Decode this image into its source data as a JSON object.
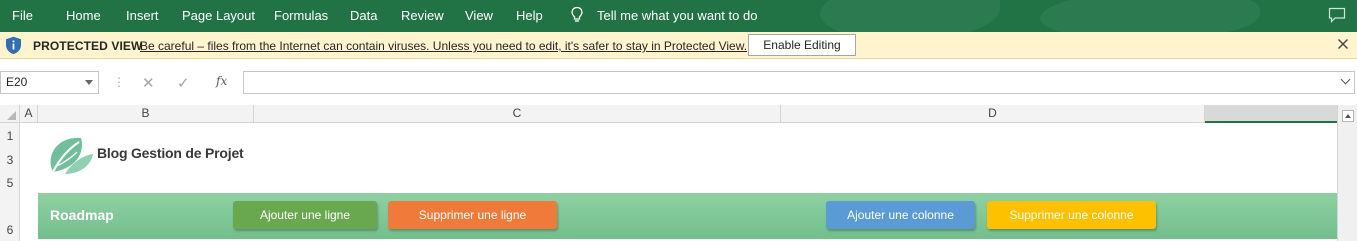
{
  "ribbon": {
    "tabs": [
      "File",
      "Home",
      "Insert",
      "Page Layout",
      "Formulas",
      "Data",
      "Review",
      "View",
      "Help"
    ],
    "tell_me": "Tell me what you want to do",
    "accent": "#217346"
  },
  "protected_view": {
    "title": "PROTECTED VIEW",
    "message": "Be careful – files from the Internet can contain viruses. Unless you need to edit, it's safer to stay in Protected View.",
    "enable_button": "Enable Editing",
    "background": "#fff4ce"
  },
  "formula_bar": {
    "name_box": "E20",
    "fx": "fx",
    "formula": ""
  },
  "grid": {
    "columns": [
      "A",
      "B",
      "C",
      "D"
    ],
    "rows": [
      "1",
      "3",
      "5",
      "6"
    ]
  },
  "sheet": {
    "brand": "Blog Gestion de Projet",
    "band_label": "Roadmap",
    "buttons": [
      {
        "label": "Ajouter une ligne",
        "color": "#6aa84f"
      },
      {
        "label": "Supprimer une ligne",
        "color": "#f07a3a"
      },
      {
        "label": "Ajouter une colonne",
        "color": "#5b9bd5"
      },
      {
        "label": "Supprimer une colonne",
        "color": "#ffc000"
      }
    ]
  }
}
